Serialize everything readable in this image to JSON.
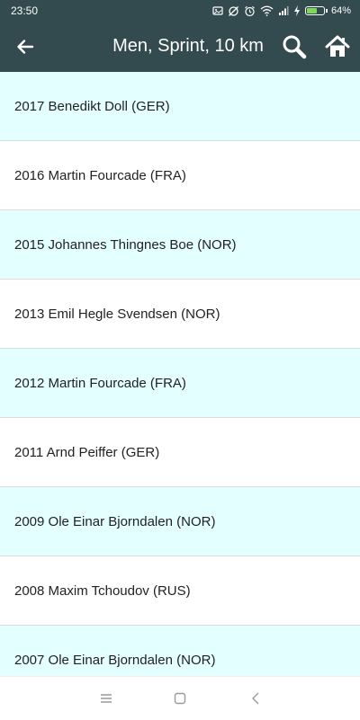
{
  "status_bar": {
    "time": "23:50",
    "battery_percent": "64%",
    "battery_level": 0.64,
    "icons": [
      "image-icon",
      "sync-off-icon",
      "alarm-icon",
      "wifi-icon",
      "signal-icon",
      "charging-icon",
      "battery-icon"
    ]
  },
  "header": {
    "title": "Men, Sprint, 10 km",
    "back_icon": "arrow-left-icon",
    "search_icon": "search-icon",
    "home_icon": "home-icon"
  },
  "results": [
    "2017 Benedikt Doll (GER)",
    "2016 Martin Fourcade (FRA)",
    "2015 Johannes Thingnes Boe (NOR)",
    "2013 Emil Hegle Svendsen (NOR)",
    "2012 Martin Fourcade (FRA)",
    "2011 Arnd Peiffer (GER)",
    "2009 Ole Einar Bjorndalen (NOR)",
    "2008 Maxim Tchoudov (RUS)",
    "2007 Ole Einar Bjorndalen (NOR)"
  ],
  "nav_bar": {
    "icons": [
      "menu-icon",
      "square-icon",
      "back-chevron-icon"
    ]
  },
  "colors": {
    "app_bar": "#334a4f",
    "row_alt": "#e4ffff",
    "row": "#ffffff",
    "divider": "#dcdcdc",
    "text": "#222222",
    "battery": "#7ed957"
  }
}
